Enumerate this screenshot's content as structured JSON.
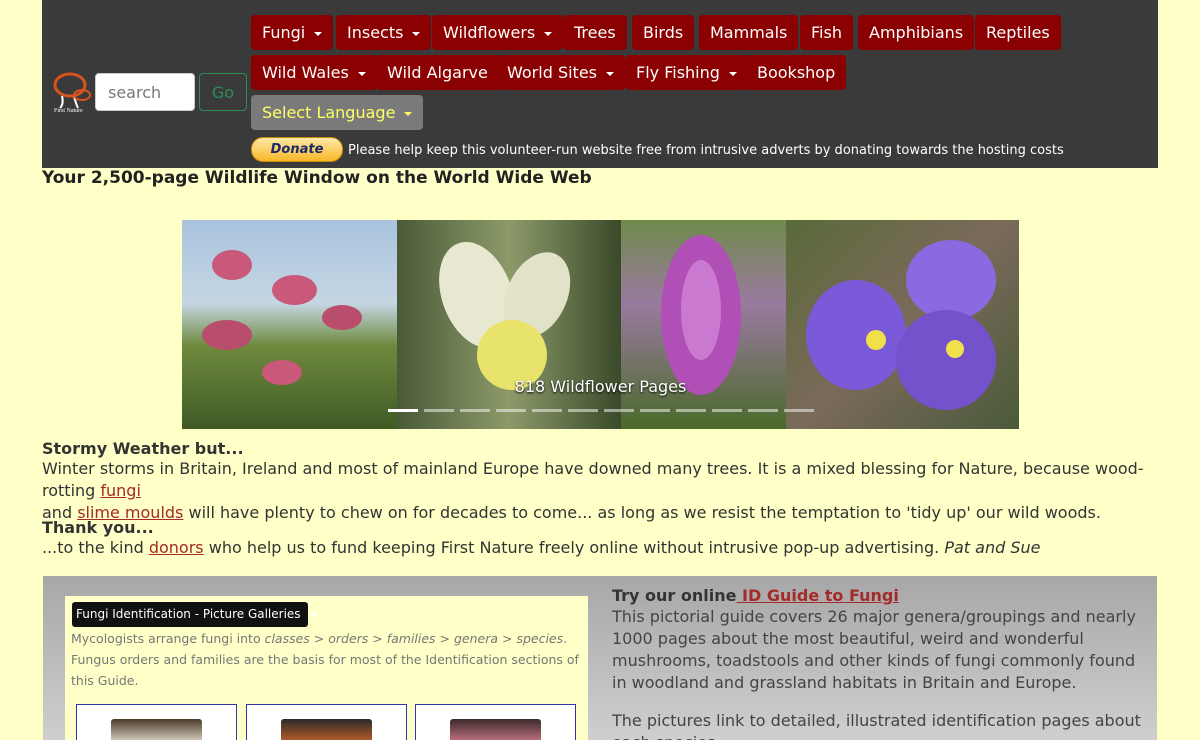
{
  "header": {
    "logo_alt": "First Nature",
    "search_placeholder": "search",
    "go_label": "Go",
    "nav_row1": [
      "Fungi",
      "Insects",
      "Wildflowers",
      "Trees",
      "Birds",
      "Mammals",
      "Fish",
      "Amphibians",
      "Reptiles"
    ],
    "nav_row2": [
      "Wild Wales",
      "Wild Algarve",
      "World Sites",
      "Fly Fishing",
      "Bookshop"
    ],
    "language_label": "Select Language",
    "donate_label": "Donate",
    "donate_text": "Please help keep this volunteer-run website free from intrusive adverts by donating towards the hosting costs"
  },
  "tagline": "Your 2,500-page Wildlife Window on the World Wide Web",
  "carousel": {
    "caption": "818 Wildflower Pages",
    "slide_count": 12,
    "active_index": 0
  },
  "news": {
    "heading": "Stormy Weather but...",
    "text_a": "Winter storms in Britain, Ireland and most of mainland Europe have downed many trees. It is a mixed blessing for Nature, because wood-rotting ",
    "link_fungi": "fungi",
    "text_b": "and ",
    "link_slime": "slime moulds",
    "text_c": " will have plenty to chew on for decades to come... as long as we resist the temptation to 'tidy up' our wild woods."
  },
  "thanks": {
    "heading": "Thank you...",
    "text_a": "...to the kind ",
    "link_donors": "donors",
    "text_b": " who help us to fund keeping First Nature freely online without intrusive pop-up advertising. ",
    "signature": "Pat and Sue"
  },
  "guide": {
    "screenshot_button": "Fungi Identification - Picture Galleries",
    "screenshot_text_a": "Mycologists arrange fungi into ",
    "screenshot_text_em": "classes > orders > families > genera > species",
    "screenshot_text_b": ". Fungus orders and families are the basis for most of the Identification sections of this Guide.",
    "try_prefix": "Try our online",
    "try_link": " ID Guide to Fungi",
    "para1": "This pictorial guide covers 26 major genera/groupings and nearly 1000 pages about the most beautiful, weird and wonderful mushrooms, toadstools and other kinds of fungi commonly found in woodland and grassland habitats in Britain and Europe.",
    "para2": "The pictures link to detailed, illustrated identification pages about each species."
  },
  "colors": {
    "nav_bg": "#3a3a3a",
    "nav_button": "#8b0000",
    "page_bg": "#ffffc8",
    "link": "#a52a2a",
    "go_button": "#2e8b57"
  }
}
